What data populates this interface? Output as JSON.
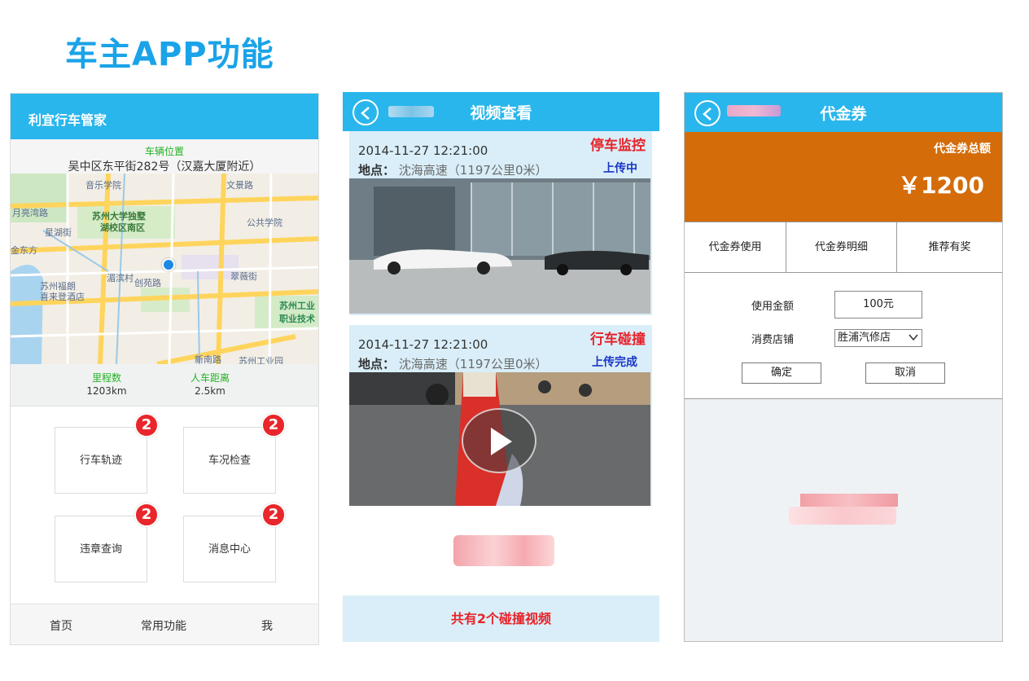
{
  "slide_title": "车主APP功能",
  "colors": {
    "title_blue": "#1aa3e8",
    "header_blue": "#29b6ec",
    "orange": "#d46c0a",
    "badge_red": "#e8262b",
    "status_red": "#e8232a"
  },
  "panel1": {
    "app_title": "利宜行车管家",
    "location_label": "车辆位置",
    "location_address": "吴中区东平街282号（汉嘉大厦附近）",
    "map_labels": [
      "音乐学院",
      "文景路",
      "苏州大学独墅",
      "湖校区南区",
      "月亮湾路",
      "公共学院",
      "金东方",
      "苏州福朗",
      "喜来登酒店",
      "湄滨村",
      "创苑路",
      "苏州工业",
      "职业技术",
      "新南路",
      "苏州工业园",
      "星湖街",
      "翠薇街"
    ],
    "stats": [
      {
        "label": "里程数",
        "value": "1203km"
      },
      {
        "label": "人车距离",
        "value": "2.5km"
      }
    ],
    "tiles": [
      {
        "label": "行车轨迹",
        "badge": "2"
      },
      {
        "label": "车况检查",
        "badge": "2"
      },
      {
        "label": "违章查询",
        "badge": "2"
      },
      {
        "label": "消息中心",
        "badge": "2"
      }
    ],
    "tabbar": [
      "首页",
      "常用功能",
      "我"
    ]
  },
  "panel2": {
    "title": "视频查看",
    "cards": [
      {
        "time": "2014-11-27 12:21:00",
        "place_label": "地点：",
        "place_value": "沈海高速（1197公里0米）",
        "status": "停车监控",
        "upload": "上传中"
      },
      {
        "time": "2014-11-27 12:21:00",
        "place_label": "地点：",
        "place_value": "沈海高速（1197公里0米）",
        "status": "行车碰撞",
        "upload": "上传完成"
      }
    ],
    "footer": "共有2个碰撞视频"
  },
  "panel3": {
    "title": "代金券",
    "total_label": "代金券总额",
    "total_value": "￥1200",
    "tabs": [
      "代金券使用",
      "代金券明细",
      "推荐有奖"
    ],
    "form": {
      "amount_label": "使用金额",
      "amount_value": "100元",
      "shop_label": "消费店铺",
      "shop_value": "胜浦汽修店",
      "confirm": "确定",
      "cancel": "取消"
    }
  }
}
